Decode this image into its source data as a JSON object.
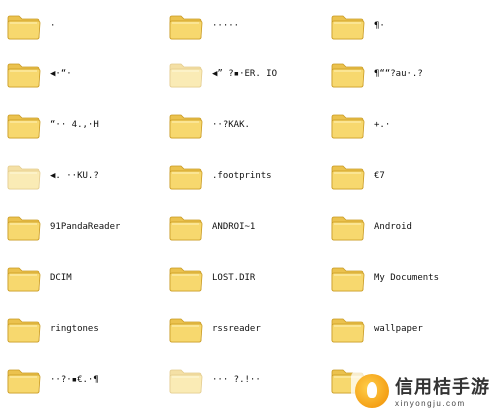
{
  "colors": {
    "folder_front": "#F7D86E",
    "folder_back": "#EBC24E",
    "folder_edge": "#C99A22"
  },
  "folder_icon": "folder-icon",
  "items": [
    {
      "label": "·",
      "dim": false
    },
    {
      "label": "·····",
      "dim": false
    },
    {
      "label": "¶·",
      "dim": false
    },
    {
      "label": "◀·“·",
      "dim": false
    },
    {
      "label": "◀” ?▪·ER. IO",
      "dim": true
    },
    {
      "label": "¶““?au·.?",
      "dim": false
    },
    {
      "label": "“··  4.,·H",
      "dim": false
    },
    {
      "label": "··?KAK.",
      "dim": false
    },
    {
      "label": "+.·",
      "dim": false
    },
    {
      "label": "◀. ··KU.?",
      "dim": true
    },
    {
      "label": ".footprints",
      "dim": false
    },
    {
      "label": "€7",
      "dim": false
    },
    {
      "label": "91PandaReader",
      "dim": false
    },
    {
      "label": "ANDROI~1",
      "dim": false
    },
    {
      "label": "Android",
      "dim": false
    },
    {
      "label": "DCIM",
      "dim": false
    },
    {
      "label": "LOST.DIR",
      "dim": false
    },
    {
      "label": "My Documents",
      "dim": false
    },
    {
      "label": "ringtones",
      "dim": false
    },
    {
      "label": "rssreader",
      "dim": false
    },
    {
      "label": "wallpaper",
      "dim": false
    },
    {
      "label": "··?·▪€.·¶",
      "dim": false
    },
    {
      "label": "··· ?.!··",
      "dim": true
    },
    {
      "label": "",
      "dim": false
    }
  ],
  "watermark": {
    "title": "信用桔手游",
    "sub": "xinyongju.com"
  }
}
